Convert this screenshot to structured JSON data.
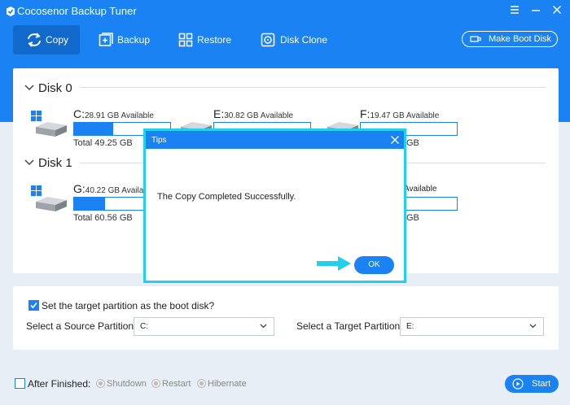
{
  "app": {
    "title": "Cocosenor Backup Tuner"
  },
  "colors": {
    "accent": "#1a82f2",
    "highlight": "#21d0ea"
  },
  "toolbar": {
    "tabs": [
      {
        "label": "Copy",
        "icon": "sync-icon",
        "active": true
      },
      {
        "label": "Backup",
        "icon": "backup-icon",
        "active": false
      },
      {
        "label": "Restore",
        "icon": "restore-icon",
        "active": false
      },
      {
        "label": "Disk Clone",
        "icon": "disk-clone-icon",
        "active": false
      }
    ],
    "boot_disk_label": "Make Boot Disk"
  },
  "disks": [
    {
      "name": "Disk 0",
      "partitions": [
        {
          "letter": "C:",
          "available": "28.91 GB Available",
          "total": "Total 49.25 GB",
          "used_fraction": 0.41,
          "icon": "windows-drive-icon"
        },
        {
          "letter": "E:",
          "available": "30.82 GB Available",
          "total": "",
          "used_fraction": 0.0,
          "icon": "drive-icon"
        },
        {
          "letter": "F:",
          "available": "19.47 GB Available",
          "total": "GB",
          "used_fraction": 0.0,
          "icon": "drive-icon"
        }
      ]
    },
    {
      "name": "Disk 1",
      "partitions": [
        {
          "letter": "G:",
          "available": "40.22 GB Available",
          "total": "Total 60.56 GB",
          "used_fraction": 0.33,
          "icon": "windows-drive-icon"
        },
        {
          "letter": "",
          "available": "Available",
          "total": "GB",
          "used_fraction": 0.0,
          "icon": ""
        }
      ]
    }
  ],
  "settings": {
    "boot_checkbox_label": "Set the target partition as the boot disk?",
    "boot_checked": true,
    "source_label": "Select a Source Partition:",
    "source_value": "C:",
    "target_label": "Select a Target Partition:",
    "target_value": "E:"
  },
  "footer": {
    "after_finished_label": "After Finished:",
    "after_finished_checked": false,
    "options": [
      "Shutdown",
      "Restart",
      "Hibernate"
    ],
    "start_label": "Start"
  },
  "dialog": {
    "title": "Tips",
    "message": "The Copy Completed Successfully.",
    "ok_label": "OK"
  }
}
